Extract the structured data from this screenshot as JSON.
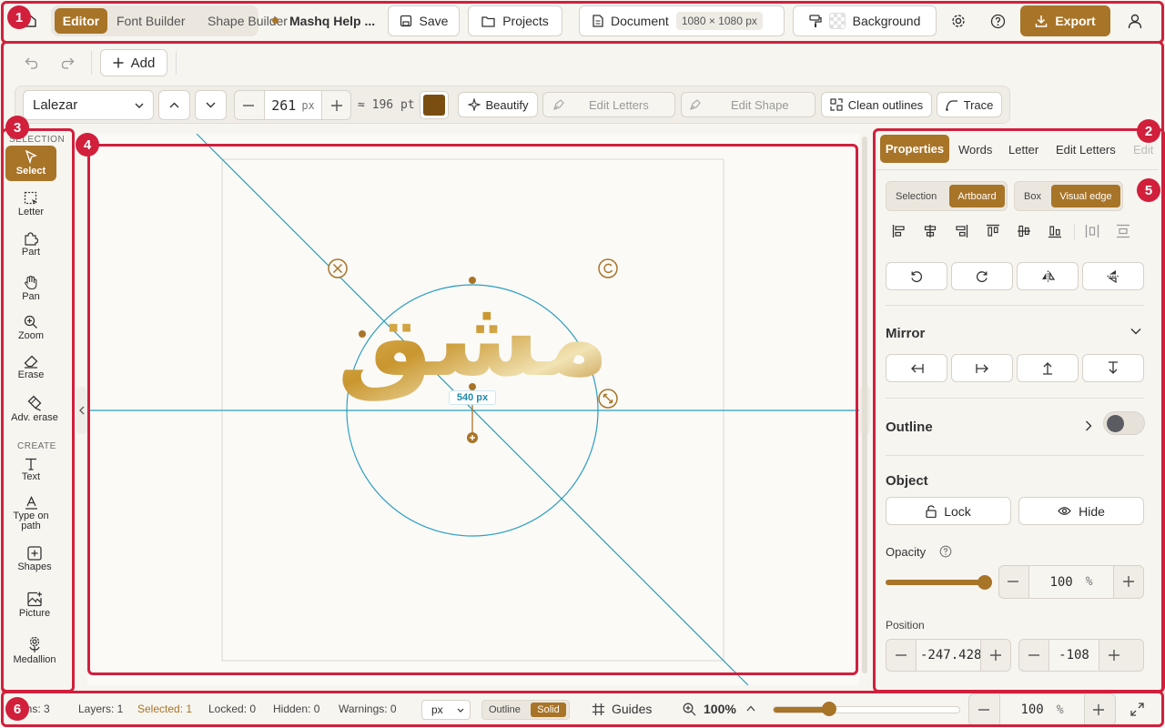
{
  "topbar": {
    "tabs": [
      "Editor",
      "Font Builder",
      "Shape Builder"
    ],
    "doc_name": "Mashq Help ...",
    "save": "Save",
    "projects": "Projects",
    "document": "Document",
    "doc_size": "1080 × 1080 px",
    "background": "Background",
    "export": "Export"
  },
  "toolbar": {
    "add": "Add",
    "font": "Lalezar",
    "size": "261",
    "size_unit": "px",
    "pt": "≈ 196 pt",
    "color": "#7a4e10",
    "beautify": "Beautify",
    "edit_letters": "Edit Letters",
    "edit_shape": "Edit Shape",
    "clean_outlines": "Clean outlines",
    "trace": "Trace"
  },
  "left": {
    "selection_label": "SELECTION",
    "create_label": "CREATE",
    "tools": {
      "select": "Select",
      "letter": "Letter",
      "part": "Part",
      "pan": "Pan",
      "zoom": "Zoom",
      "erase": "Erase",
      "adv_erase": "Adv. erase",
      "text": "Text",
      "type_on_path": "Type on path",
      "shapes": "Shapes",
      "picture": "Picture",
      "medallion": "Medallion"
    }
  },
  "canvas": {
    "glyph_text": "مشق",
    "radius_label": "540 px"
  },
  "right": {
    "tabs": [
      "Properties",
      "Words",
      "Letter",
      "Edit Letters",
      "Edit"
    ],
    "seg1": [
      "Selection",
      "Artboard"
    ],
    "seg2": [
      "Box",
      "Visual edge"
    ],
    "mirror": "Mirror",
    "outline": "Outline",
    "object": "Object",
    "lock": "Lock",
    "hide": "Hide",
    "opacity": "Opacity",
    "opacity_value": "100",
    "opacity_unit": "%",
    "opacity_level": 1.0,
    "position": "Position",
    "pos_x": "-247.428",
    "pos_y": "-108"
  },
  "status": {
    "glyphs": "phs: 3",
    "layers": "Layers: 1",
    "selected": "Selected: 1",
    "locked": "Locked: 0",
    "hidden": "Hidden: 0",
    "warnings": "Warnings: 0",
    "unit": "px",
    "outline": "Outline",
    "solid": "Solid",
    "guides": "Guides",
    "zoom": "100%",
    "zoom_value": "100",
    "zoom_unit": "%",
    "zoom_level": 0.3
  },
  "annotations": [
    "1",
    "2",
    "3",
    "4",
    "5",
    "6"
  ],
  "colors": {
    "accent": "#a87428",
    "annotation": "#d11f3c",
    "guide": "#2a9ec0"
  }
}
